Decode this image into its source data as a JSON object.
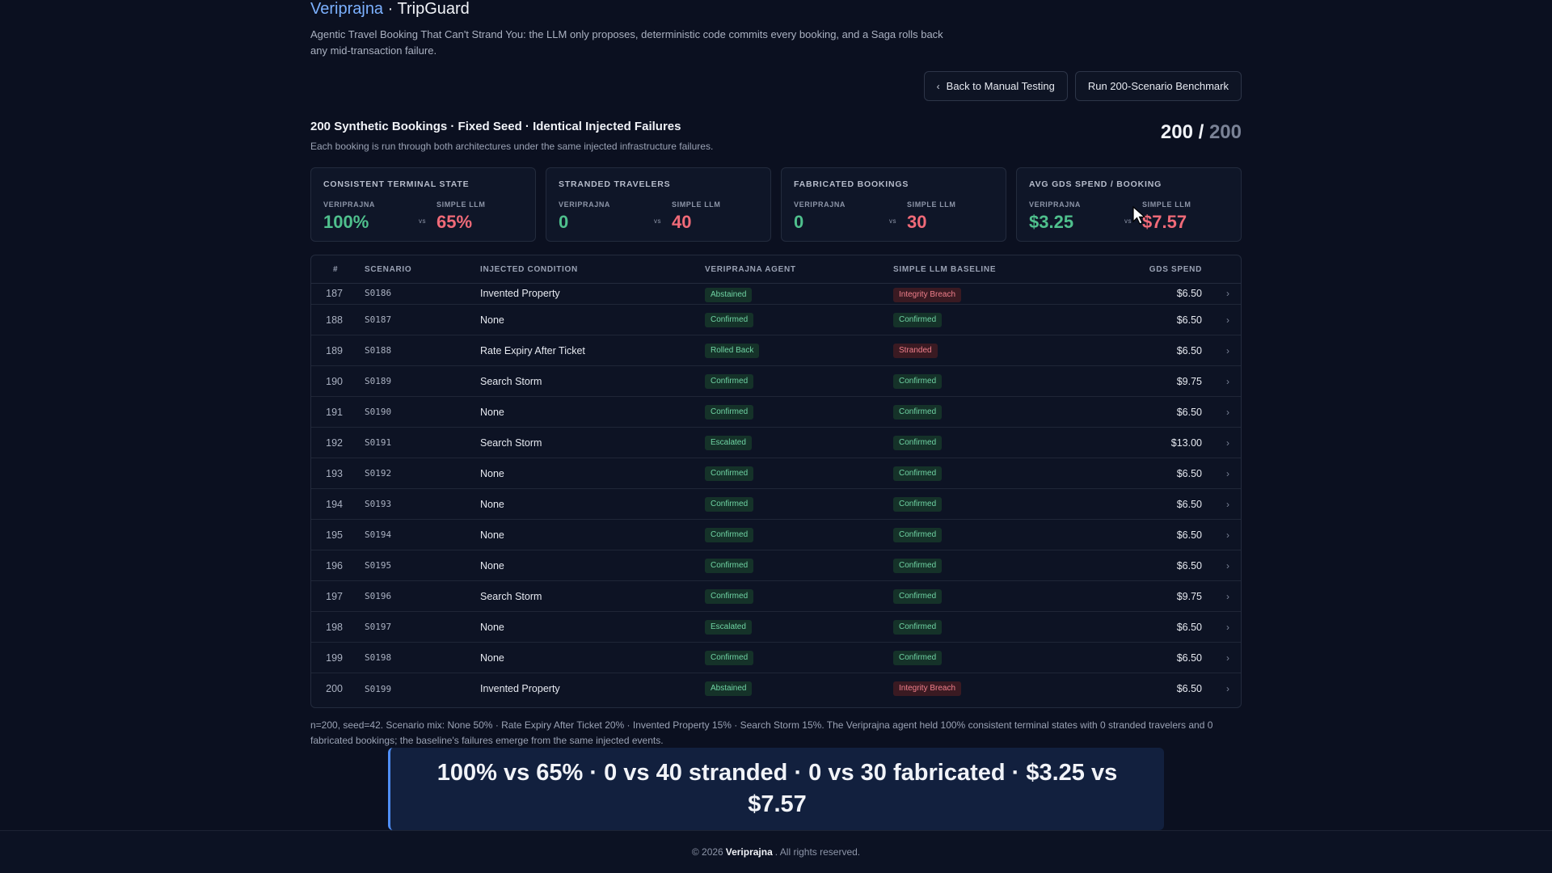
{
  "header": {
    "brand": "Veriprajna",
    "separator": "·",
    "product": "TripGuard",
    "subtitle": "Agentic Travel Booking That Can't Strand You: the LLM only proposes, deterministic code commits every booking, and a Saga rolls back any mid-transaction failure."
  },
  "actions": {
    "back_label": "Back to Manual Testing",
    "run_label": "Run 200-Scenario Benchmark"
  },
  "section": {
    "title": "200 Synthetic Bookings · Fixed Seed · Identical Injected Failures",
    "description": "Each booking is run through both architectures under the same injected infrastructure failures.",
    "progress_done": "200",
    "progress_sep": "/",
    "progress_total": "200"
  },
  "cards": [
    {
      "title": "Consistent Terminal State",
      "left_label": "Veriprajna",
      "left_value": "100%",
      "vs": "vs",
      "right_label": "Simple LLM",
      "right_value": "65%"
    },
    {
      "title": "Stranded Travelers",
      "left_label": "Veriprajna",
      "left_value": "0",
      "vs": "vs",
      "right_label": "Simple LLM",
      "right_value": "40"
    },
    {
      "title": "Fabricated Bookings",
      "left_label": "Veriprajna",
      "left_value": "0",
      "vs": "vs",
      "right_label": "Simple LLM",
      "right_value": "30"
    },
    {
      "title": "Avg GDS Spend / Booking",
      "left_label": "Veriprajna",
      "left_value": "$3.25",
      "vs": "vs",
      "right_label": "Simple LLM",
      "right_value": "$7.57"
    }
  ],
  "table": {
    "headers": {
      "num": "#",
      "scenario": "Scenario",
      "injected": "Injected Condition",
      "agent": "Veriprajna Agent",
      "baseline": "Simple LLM Baseline",
      "spend": "GDS Spend"
    },
    "rows": [
      {
        "num": "187",
        "scenario": "S0186",
        "injected": "Invented Property",
        "agent": "Abstained",
        "agent_tone": "green",
        "baseline": "Integrity Breach",
        "baseline_tone": "red",
        "spend": "$6.50"
      },
      {
        "num": "188",
        "scenario": "S0187",
        "injected": "None",
        "agent": "Confirmed",
        "agent_tone": "green",
        "baseline": "Confirmed",
        "baseline_tone": "green",
        "spend": "$6.50"
      },
      {
        "num": "189",
        "scenario": "S0188",
        "injected": "Rate Expiry After Ticket",
        "agent": "Rolled Back",
        "agent_tone": "green",
        "baseline": "Stranded",
        "baseline_tone": "red",
        "spend": "$6.50"
      },
      {
        "num": "190",
        "scenario": "S0189",
        "injected": "Search Storm",
        "agent": "Confirmed",
        "agent_tone": "green",
        "baseline": "Confirmed",
        "baseline_tone": "green",
        "spend": "$9.75"
      },
      {
        "num": "191",
        "scenario": "S0190",
        "injected": "None",
        "agent": "Confirmed",
        "agent_tone": "green",
        "baseline": "Confirmed",
        "baseline_tone": "green",
        "spend": "$6.50"
      },
      {
        "num": "192",
        "scenario": "S0191",
        "injected": "Search Storm",
        "agent": "Escalated",
        "agent_tone": "green",
        "baseline": "Confirmed",
        "baseline_tone": "green",
        "spend": "$13.00"
      },
      {
        "num": "193",
        "scenario": "S0192",
        "injected": "None",
        "agent": "Confirmed",
        "agent_tone": "green",
        "baseline": "Confirmed",
        "baseline_tone": "green",
        "spend": "$6.50"
      },
      {
        "num": "194",
        "scenario": "S0193",
        "injected": "None",
        "agent": "Confirmed",
        "agent_tone": "green",
        "baseline": "Confirmed",
        "baseline_tone": "green",
        "spend": "$6.50"
      },
      {
        "num": "195",
        "scenario": "S0194",
        "injected": "None",
        "agent": "Confirmed",
        "agent_tone": "green",
        "baseline": "Confirmed",
        "baseline_tone": "green",
        "spend": "$6.50"
      },
      {
        "num": "196",
        "scenario": "S0195",
        "injected": "None",
        "agent": "Confirmed",
        "agent_tone": "green",
        "baseline": "Confirmed",
        "baseline_tone": "green",
        "spend": "$6.50"
      },
      {
        "num": "197",
        "scenario": "S0196",
        "injected": "Search Storm",
        "agent": "Confirmed",
        "agent_tone": "green",
        "baseline": "Confirmed",
        "baseline_tone": "green",
        "spend": "$9.75"
      },
      {
        "num": "198",
        "scenario": "S0197",
        "injected": "None",
        "agent": "Escalated",
        "agent_tone": "green",
        "baseline": "Confirmed",
        "baseline_tone": "green",
        "spend": "$6.50"
      },
      {
        "num": "199",
        "scenario": "S0198",
        "injected": "None",
        "agent": "Confirmed",
        "agent_tone": "green",
        "baseline": "Confirmed",
        "baseline_tone": "green",
        "spend": "$6.50"
      },
      {
        "num": "200",
        "scenario": "S0199",
        "injected": "Invented Property",
        "agent": "Abstained",
        "agent_tone": "green",
        "baseline": "Integrity Breach",
        "baseline_tone": "red",
        "spend": "$6.50"
      }
    ]
  },
  "footnote": "n=200, seed=42. Scenario mix: None 50% · Rate Expiry After Ticket 20% · Invented Property 15% · Search Storm 15%. The Veriprajna agent held 100% consistent terminal states with 0 stranded travelers and 0 fabricated bookings; the baseline's failures emerge from the same injected events.",
  "banner": "100% vs 65% · 0 vs 40 stranded · 0 vs 30 fabricated · $3.25 vs $7.57",
  "footer": {
    "prefix": "© 2026",
    "brand": "Veriprajna",
    "suffix": ". All rights reserved."
  },
  "colors": {
    "accent": "#4f8ef7",
    "good": "#4fc08d",
    "bad": "#f06a78",
    "background": "#0b1020"
  }
}
